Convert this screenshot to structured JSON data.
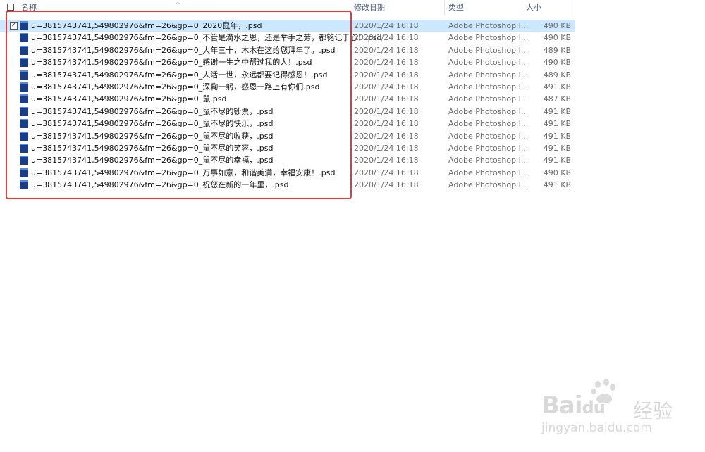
{
  "columns": {
    "name": "名称",
    "date": "修改日期",
    "type": "类型",
    "size": "大小"
  },
  "files": [
    {
      "name": "u=3815743741,549802976&fm=26&gp=0_2020鼠年，.psd",
      "date": "2020/1/24 16:18",
      "type": "Adobe Photoshop I...",
      "size": "490 KB",
      "selected": true
    },
    {
      "name": "u=3815743741,549802976&fm=26&gp=0_不管是滴水之恩，还是举手之劳，都铭记于心！.psd",
      "date": "2020/1/24 16:18",
      "type": "Adobe Photoshop I...",
      "size": "490 KB"
    },
    {
      "name": "u=3815743741,549802976&fm=26&gp=0_大年三十，木木在这给您拜年了。.psd",
      "date": "2020/1/24 16:18",
      "type": "Adobe Photoshop I...",
      "size": "489 KB"
    },
    {
      "name": "u=3815743741,549802976&fm=26&gp=0_感谢一生之中帮过我的人！.psd",
      "date": "2020/1/24 16:18",
      "type": "Adobe Photoshop I...",
      "size": "490 KB"
    },
    {
      "name": "u=3815743741,549802976&fm=26&gp=0_人活一世，永远都要记得感恩！.psd",
      "date": "2020/1/24 16:18",
      "type": "Adobe Photoshop I...",
      "size": "489 KB"
    },
    {
      "name": "u=3815743741,549802976&fm=26&gp=0_深鞠一躬，感恩一路上有你们.psd",
      "date": "2020/1/24 16:18",
      "type": "Adobe Photoshop I...",
      "size": "491 KB"
    },
    {
      "name": "u=3815743741,549802976&fm=26&gp=0_鼠.psd",
      "date": "2020/1/24 16:18",
      "type": "Adobe Photoshop I...",
      "size": "487 KB"
    },
    {
      "name": "u=3815743741,549802976&fm=26&gp=0_鼠不尽的钞票，.psd",
      "date": "2020/1/24 16:18",
      "type": "Adobe Photoshop I...",
      "size": "491 KB"
    },
    {
      "name": "u=3815743741,549802976&fm=26&gp=0_鼠不尽的快乐，.psd",
      "date": "2020/1/24 16:18",
      "type": "Adobe Photoshop I...",
      "size": "491 KB"
    },
    {
      "name": "u=3815743741,549802976&fm=26&gp=0_鼠不尽的收获，.psd",
      "date": "2020/1/24 16:18",
      "type": "Adobe Photoshop I...",
      "size": "491 KB"
    },
    {
      "name": "u=3815743741,549802976&fm=26&gp=0_鼠不尽的笑容，.psd",
      "date": "2020/1/24 16:18",
      "type": "Adobe Photoshop I...",
      "size": "491 KB"
    },
    {
      "name": "u=3815743741,549802976&fm=26&gp=0_鼠不尽的幸福，.psd",
      "date": "2020/1/24 16:18",
      "type": "Adobe Photoshop I...",
      "size": "491 KB"
    },
    {
      "name": "u=3815743741,549802976&fm=26&gp=0_万事如意，和谐美满，幸福安康！.psd",
      "date": "2020/1/24 16:18",
      "type": "Adobe Photoshop I...",
      "size": "490 KB"
    },
    {
      "name": "u=3815743741,549802976&fm=26&gp=0_祝您在新的一年里，.psd",
      "date": "2020/1/24 16:18",
      "type": "Adobe Photoshop I...",
      "size": "491 KB"
    }
  ],
  "icons": {
    "file_icon": "photoshop-file-icon",
    "check": "✓"
  },
  "colors": {
    "selection": "#cce8ff",
    "highlight_box": "#e23b3b",
    "header_text": "#4c607a"
  },
  "watermark": {
    "brand": "Bai",
    "brand_suffix": "du",
    "brand_cn": "经验",
    "url": "jingyan.baidu.com"
  }
}
